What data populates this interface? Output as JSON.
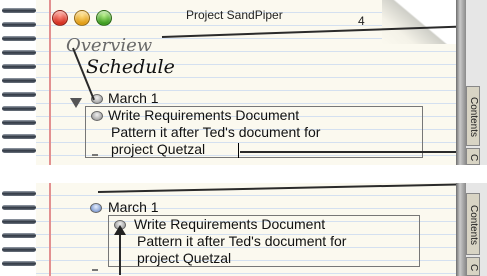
{
  "window": {
    "title": "Project SandPiper",
    "page_number": "4"
  },
  "tabs": {
    "overview": "Overview",
    "schedule": "Schedule"
  },
  "top": {
    "heading": "March 1",
    "item_title": "Write Requirements Document",
    "item_note_line1": "Pattern it after Ted's document for",
    "item_note_line2": "project Quetzal",
    "side_tab_labels": [
      "Contents",
      "C"
    ]
  },
  "bottom": {
    "heading": "March 1",
    "item_title": "Write Requirements Document",
    "item_note_line1": "Pattern it after Ted's document for",
    "item_note_line2": "project Quetzal",
    "side_tab_labels": [
      "Contents",
      "C"
    ]
  },
  "icons": {
    "close": "close-button",
    "minimize": "minimize-button",
    "zoom": "zoom-button",
    "bullet": "outline-bullet-icon",
    "arrow": "down-arrow-icon"
  },
  "colors": {
    "page": "#fbf9ef",
    "rule_lines": "#d4e0f0",
    "margin_line": "#e29090",
    "close": "#d32b1c",
    "minimize": "#e09b12",
    "zoom": "#3a9a1c"
  }
}
